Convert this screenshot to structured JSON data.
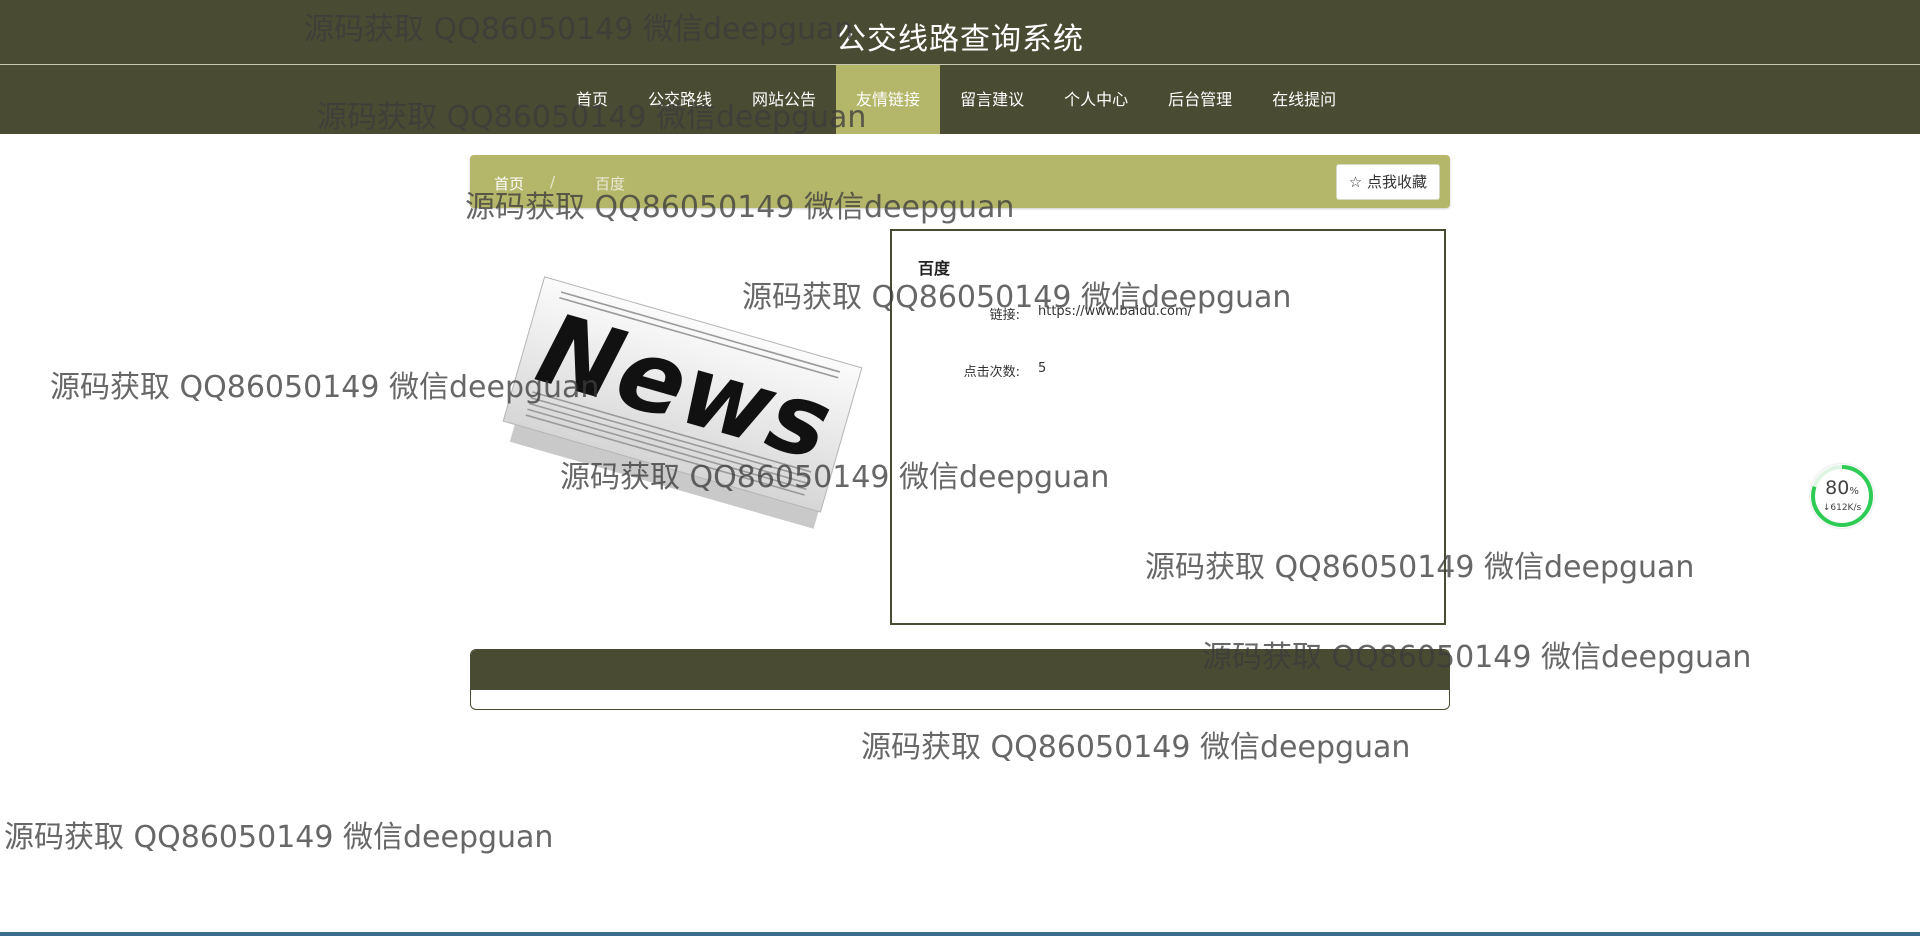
{
  "header": {
    "title": "公交线路查询系统"
  },
  "nav": {
    "items": [
      {
        "label": "首页"
      },
      {
        "label": "公交路线"
      },
      {
        "label": "网站公告"
      },
      {
        "label": "友情链接"
      },
      {
        "label": "留言建议"
      },
      {
        "label": "个人中心"
      },
      {
        "label": "后台管理"
      },
      {
        "label": "在线提问"
      }
    ],
    "active_index": 3
  },
  "breadcrumb": {
    "home": "首页",
    "separator": "/",
    "current": "百度",
    "favorite_icon": "star-outline-icon",
    "favorite_label": "点我收藏"
  },
  "image": {
    "headline": "News"
  },
  "detail": {
    "title": "百度",
    "link_label": "链接:",
    "link_value": "https://www.baidu.com/",
    "clicks_label": "点击次数:",
    "clicks_value": "5"
  },
  "watermark": "源码获取 QQ86050149 微信deepguan",
  "speed_widget": {
    "percent": "80",
    "unit": "%",
    "rate": "↓612K/s"
  },
  "colors": {
    "primary": "#4a4b33",
    "accent": "#b4b76a"
  }
}
